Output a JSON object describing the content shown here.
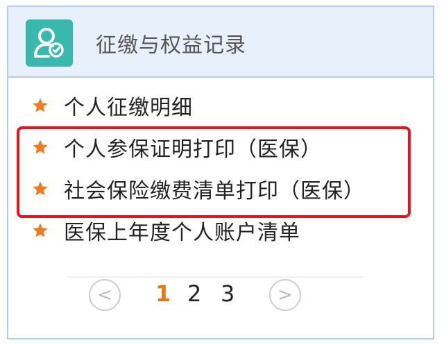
{
  "header": {
    "title": "征缴与权益记录",
    "icon": "user-shield-icon",
    "icon_bg": "#39b9ad"
  },
  "menu": {
    "items": [
      {
        "label": "个人征缴明细",
        "icon": "star-icon"
      },
      {
        "label": "个人参保证明打印（医保）",
        "icon": "star-icon"
      },
      {
        "label": "社会保险缴费清单打印（医保）",
        "icon": "star-icon"
      },
      {
        "label": "医保上年度个人账户清单",
        "icon": "star-icon"
      }
    ],
    "star_color": "#f07c1f",
    "highlight_color": "#e8141c"
  },
  "pager": {
    "prev": "<",
    "next": ">",
    "pages": [
      "1",
      "2",
      "3"
    ],
    "current": "1",
    "active_color": "#e87615"
  }
}
